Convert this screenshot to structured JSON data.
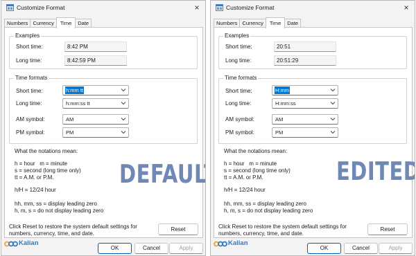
{
  "colors": {
    "accent": "#0078d4",
    "stamp": "#6f88b4",
    "logo_blue": "#2f7ac0",
    "logo_orange": "#f0a030"
  },
  "dialogs": [
    {
      "title": "Customize Format",
      "close_icon": "×",
      "tabs": [
        "Numbers",
        "Currency",
        "Time",
        "Date"
      ],
      "active_tab": "Time",
      "examples_title": "Examples",
      "short_time_label": "Short time:",
      "short_time_example": "8:42 PM",
      "long_time_label": "Long time:",
      "long_time_example": "8:42:59 PM",
      "formats_title": "Time formats",
      "short_time_fmt_label": "Short time:",
      "short_time_fmt_value": "h:mm tt",
      "long_time_fmt_label": "Long time:",
      "long_time_fmt_value": "h:mm:ss tt",
      "am_label": "AM symbol:",
      "am_value": "AM",
      "pm_label": "PM symbol:",
      "pm_value": "PM",
      "notations_title": "What the notations mean:",
      "notes_1": "h = hour   m = minute\ns = second (long time only)\ntt = A.M. or P.M.",
      "notes_2": "h/H = 12/24 hour",
      "notes_3": "hh, mm, ss = display leading zero\nh, m, s = do not display leading zero",
      "reset_text": "Click Reset to restore the system default settings for numbers, currency, time, and date.",
      "reset_label": "Reset",
      "ok_label": "OK",
      "cancel_label": "Cancel",
      "apply_label": "Apply",
      "stamp": "DEFAULT",
      "logo": "Kalian"
    },
    {
      "title": "Customize Format",
      "close_icon": "×",
      "tabs": [
        "Numbers",
        "Currency",
        "Time",
        "Date"
      ],
      "active_tab": "Time",
      "examples_title": "Examples",
      "short_time_label": "Short time:",
      "short_time_example": "20:51",
      "long_time_label": "Long time:",
      "long_time_example": "20:51:29",
      "formats_title": "Time formats",
      "short_time_fmt_label": "Short time:",
      "short_time_fmt_value": "H:mm",
      "long_time_fmt_label": "Long time:",
      "long_time_fmt_value": "H:mm:ss",
      "am_label": "AM symbol:",
      "am_value": "AM",
      "pm_label": "PM symbol:",
      "pm_value": "PM",
      "notations_title": "What the notations mean:",
      "notes_1": "h = hour   m = minute\ns = second (long time only)\ntt = A.M. or P.M.",
      "notes_2": "h/H = 12/24 hour",
      "notes_3": "hh, mm, ss = display leading zero\nh, m, s = do not display leading zero",
      "reset_text": "Click Reset to restore the system default settings for numbers, currency, time, and date.",
      "reset_label": "Reset",
      "ok_label": "OK",
      "cancel_label": "Cancel",
      "apply_label": "Apply",
      "stamp": "EDITED",
      "logo": "Kalian"
    }
  ]
}
